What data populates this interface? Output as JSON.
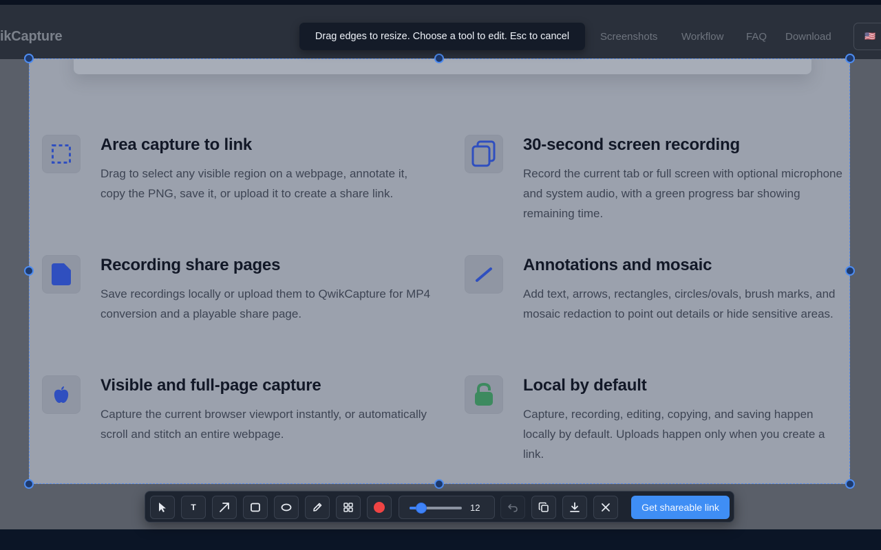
{
  "site": {
    "brand": "ikCapture",
    "nav": [
      "Screenshots",
      "Workflow",
      "FAQ",
      "Download"
    ],
    "language_flag": "🇺🇸"
  },
  "overlay": {
    "tooltip": "Drag edges to resize. Choose a tool to edit. Esc to cancel"
  },
  "features": [
    {
      "icon": "dashed-selection-icon",
      "title": "Area capture to link",
      "description": "Drag to select any visible region on a webpage, annotate it, copy the PNG, save it, or upload it to create a share link."
    },
    {
      "icon": "copy-stack-icon",
      "title": "30-second screen recording",
      "description": "Record the current tab or full screen with optional microphone and system audio, with a green progress bar showing remaining time."
    },
    {
      "icon": "document-icon",
      "title": "Recording share pages",
      "description": "Save recordings locally or upload them to QwikCapture for MP4 conversion and a playable share page."
    },
    {
      "icon": "pen-stroke-icon",
      "title": "Annotations and mosaic",
      "description": "Add text, arrows, rectangles, circles/ovals, brush marks, and mosaic redaction to point out details or hide sensitive areas."
    },
    {
      "icon": "apple-icon",
      "title": "Visible and full-page capture",
      "description": "Capture the current browser viewport instantly, or automatically scroll and stitch an entire webpage."
    },
    {
      "icon": "lock-icon",
      "title": "Local by default",
      "description": "Capture, recording, editing, copying, and saving happen locally by default. Uploads happen only when you create a link."
    }
  ],
  "toolbar": {
    "tools": [
      "select-tool-icon",
      "text-tool-icon",
      "arrow-tool-icon",
      "rectangle-tool-icon",
      "ellipse-tool-icon",
      "pen-tool-icon",
      "mosaic-tool-icon",
      "color-picker-icon"
    ],
    "text_tool_label": "T",
    "active_color": "#ef4444",
    "stroke_size": "12",
    "stroke_size_fraction": 0.12,
    "actions": [
      "undo-icon",
      "copy-icon",
      "download-icon",
      "close-icon"
    ],
    "share_label": "Get shareable link"
  },
  "colors": {
    "accent": "#3f8ef5",
    "icon_blue": "#2f4fbf",
    "icon_green": "#3d8a5f"
  }
}
